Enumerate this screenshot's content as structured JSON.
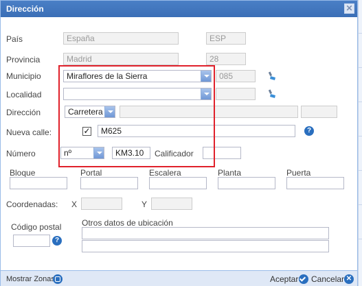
{
  "dialog": {
    "title": "Dirección",
    "close_glyph": "✕"
  },
  "labels": {
    "pais": "País",
    "provincia": "Provincia",
    "municipio": "Municipio",
    "localidad": "Localidad",
    "direccion": "Dirección",
    "nueva_calle": "Nueva calle:",
    "numero": "Número",
    "calificador": "Calificador",
    "bloque": "Bloque",
    "portal": "Portal",
    "escalera": "Escalera",
    "planta": "Planta",
    "puerta": "Puerta",
    "coordenadas": "Coordenadas:",
    "coord_x": "X",
    "coord_y": "Y",
    "codigo_postal": "Código postal",
    "otros_datos": "Otros datos de ubicación"
  },
  "fields": {
    "pais_name": "España",
    "pais_code": "ESP",
    "provincia_name": "Madrid",
    "provincia_code": "28",
    "municipio_value": "Miraflores de la Sierra",
    "municipio_code": "085",
    "localidad_value": "",
    "direccion_tipo": "Carretera",
    "direccion_nombre": "",
    "direccion_extra": "",
    "nueva_calle_checked": true,
    "nueva_calle_value": "M625",
    "numero_tipo": "nº",
    "numero_value": "KM3.10",
    "calificador_value": "",
    "bloque_value": "",
    "portal_value": "",
    "escalera_value": "",
    "planta_value": "",
    "puerta_value": "",
    "coord_x_value": "",
    "coord_y_value": "",
    "codigo_postal_value": "",
    "otros_linea1": "",
    "otros_linea2": ""
  },
  "footer": {
    "zonas_label": "Mostrar Zonas",
    "accept_label": "Aceptar",
    "cancel_label": "Cancelar"
  },
  "glyphs": {
    "help": "?",
    "check": "✓",
    "cancel": "✕"
  },
  "icons": [
    "broom-icon",
    "help-icon",
    "checkbox-icon",
    "zones-icon",
    "accept-icon",
    "cancel-icon",
    "close-icon"
  ],
  "colors": {
    "title_bar": "#3b6fb6",
    "highlight_box": "#e0202a",
    "help_icon": "#2a6fbf"
  }
}
